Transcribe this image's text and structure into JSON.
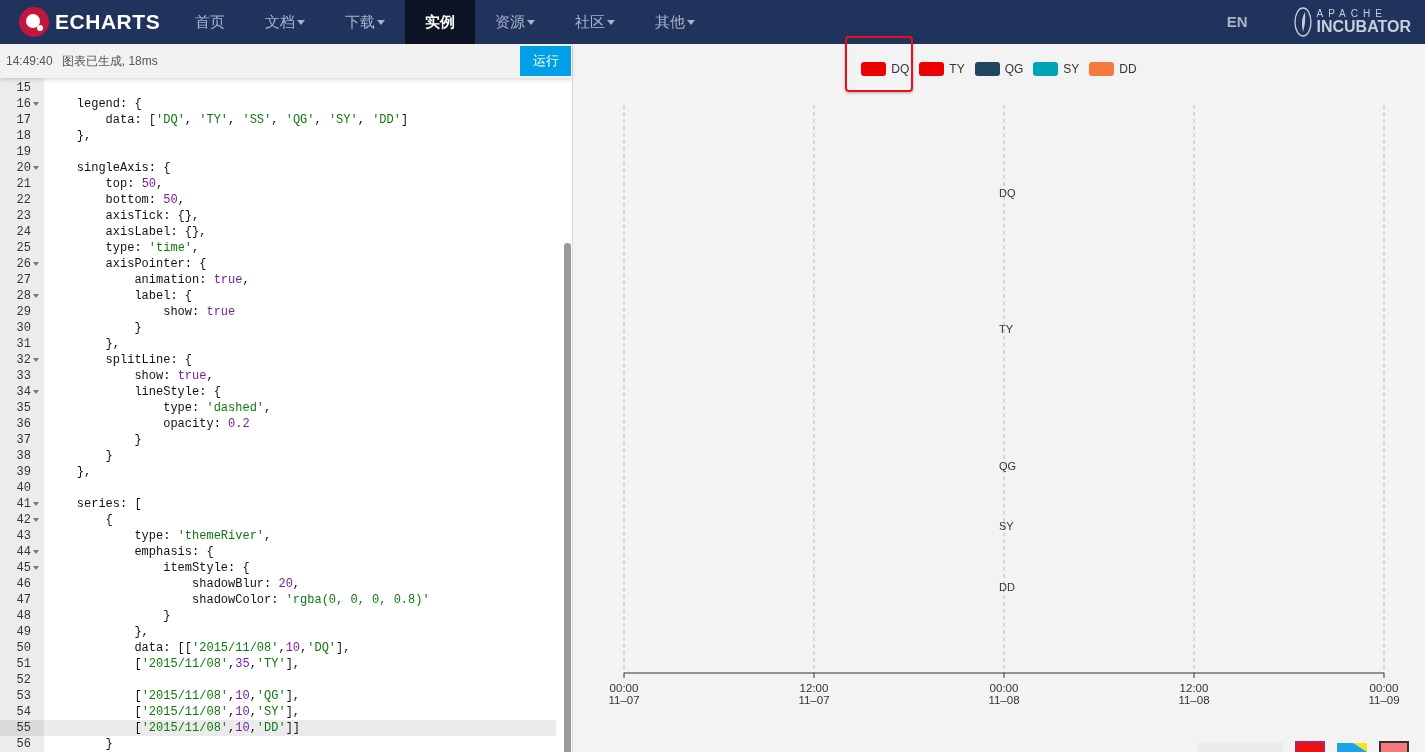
{
  "nav": {
    "brand": "ECHARTS",
    "items": [
      {
        "label": "首页",
        "dropdown": false,
        "selected": false
      },
      {
        "label": "文档",
        "dropdown": true,
        "selected": false
      },
      {
        "label": "下载",
        "dropdown": true,
        "selected": false
      },
      {
        "label": "实例",
        "dropdown": false,
        "selected": true
      },
      {
        "label": "资源",
        "dropdown": true,
        "selected": false
      },
      {
        "label": "社区",
        "dropdown": true,
        "selected": false
      },
      {
        "label": "其他",
        "dropdown": true,
        "selected": false
      }
    ],
    "language": "EN",
    "incubator": {
      "top": "APACHE",
      "bottom": "INCUBATOR"
    }
  },
  "status_bar": {
    "time": "14:49:40",
    "message": "图表已生成, 18ms",
    "run_button": "运行"
  },
  "editor": {
    "lines": [
      {
        "number": "15",
        "fold": false,
        "current": false
      },
      {
        "number": "16",
        "fold": true,
        "current": false,
        "tokens": [
          {
            "kind": "plain",
            "text": "    legend: {"
          }
        ]
      },
      {
        "number": "17",
        "fold": false,
        "current": false,
        "tokens": [
          {
            "kind": "plain",
            "text": "        data: ["
          },
          {
            "kind": "string",
            "text": "'DQ'"
          },
          {
            "kind": "plain",
            "text": ", "
          },
          {
            "kind": "string",
            "text": "'TY'"
          },
          {
            "kind": "plain",
            "text": ", "
          },
          {
            "kind": "string",
            "text": "'SS'"
          },
          {
            "kind": "plain",
            "text": ", "
          },
          {
            "kind": "string",
            "text": "'QG'"
          },
          {
            "kind": "plain",
            "text": ", "
          },
          {
            "kind": "string",
            "text": "'SY'"
          },
          {
            "kind": "plain",
            "text": ", "
          },
          {
            "kind": "string",
            "text": "'DD'"
          },
          {
            "kind": "plain",
            "text": "]"
          }
        ]
      },
      {
        "number": "18",
        "fold": false,
        "current": false,
        "tokens": [
          {
            "kind": "plain",
            "text": "    },"
          }
        ]
      },
      {
        "number": "19",
        "fold": false,
        "current": false
      },
      {
        "number": "20",
        "fold": true,
        "current": false,
        "tokens": [
          {
            "kind": "plain",
            "text": "    singleAxis: {"
          }
        ]
      },
      {
        "number": "21",
        "fold": false,
        "current": false,
        "tokens": [
          {
            "kind": "plain",
            "text": "        top: "
          },
          {
            "kind": "literal",
            "text": "50"
          },
          {
            "kind": "plain",
            "text": ","
          }
        ]
      },
      {
        "number": "22",
        "fold": false,
        "current": false,
        "tokens": [
          {
            "kind": "plain",
            "text": "        bottom: "
          },
          {
            "kind": "literal",
            "text": "50"
          },
          {
            "kind": "plain",
            "text": ","
          }
        ]
      },
      {
        "number": "23",
        "fold": false,
        "current": false,
        "tokens": [
          {
            "kind": "plain",
            "text": "        axisTick: {},"
          }
        ]
      },
      {
        "number": "24",
        "fold": false,
        "current": false,
        "tokens": [
          {
            "kind": "plain",
            "text": "        axisLabel: {},"
          }
        ]
      },
      {
        "number": "25",
        "fold": false,
        "current": false,
        "tokens": [
          {
            "kind": "plain",
            "text": "        type: "
          },
          {
            "kind": "string",
            "text": "'time'"
          },
          {
            "kind": "plain",
            "text": ","
          }
        ]
      },
      {
        "number": "26",
        "fold": true,
        "current": false,
        "tokens": [
          {
            "kind": "plain",
            "text": "        axisPointer: {"
          }
        ]
      },
      {
        "number": "27",
        "fold": false,
        "current": false,
        "tokens": [
          {
            "kind": "plain",
            "text": "            animation: "
          },
          {
            "kind": "literal",
            "text": "true"
          },
          {
            "kind": "plain",
            "text": ","
          }
        ]
      },
      {
        "number": "28",
        "fold": true,
        "current": false,
        "tokens": [
          {
            "kind": "plain",
            "text": "            label: {"
          }
        ]
      },
      {
        "number": "29",
        "fold": false,
        "current": false,
        "tokens": [
          {
            "kind": "plain",
            "text": "                show: "
          },
          {
            "kind": "literal",
            "text": "true"
          }
        ]
      },
      {
        "number": "30",
        "fold": false,
        "current": false,
        "tokens": [
          {
            "kind": "plain",
            "text": "            }"
          }
        ]
      },
      {
        "number": "31",
        "fold": false,
        "current": false,
        "tokens": [
          {
            "kind": "plain",
            "text": "        },"
          }
        ]
      },
      {
        "number": "32",
        "fold": true,
        "current": false,
        "tokens": [
          {
            "kind": "plain",
            "text": "        splitLine: {"
          }
        ]
      },
      {
        "number": "33",
        "fold": false,
        "current": false,
        "tokens": [
          {
            "kind": "plain",
            "text": "            show: "
          },
          {
            "kind": "literal",
            "text": "true"
          },
          {
            "kind": "plain",
            "text": ","
          }
        ]
      },
      {
        "number": "34",
        "fold": true,
        "current": false,
        "tokens": [
          {
            "kind": "plain",
            "text": "            lineStyle: {"
          }
        ]
      },
      {
        "number": "35",
        "fold": false,
        "current": false,
        "tokens": [
          {
            "kind": "plain",
            "text": "                type: "
          },
          {
            "kind": "string",
            "text": "'dashed'"
          },
          {
            "kind": "plain",
            "text": ","
          }
        ]
      },
      {
        "number": "36",
        "fold": false,
        "current": false,
        "tokens": [
          {
            "kind": "plain",
            "text": "                opacity: "
          },
          {
            "kind": "literal",
            "text": "0.2"
          }
        ]
      },
      {
        "number": "37",
        "fold": false,
        "current": false,
        "tokens": [
          {
            "kind": "plain",
            "text": "            }"
          }
        ]
      },
      {
        "number": "38",
        "fold": false,
        "current": false,
        "tokens": [
          {
            "kind": "plain",
            "text": "        }"
          }
        ]
      },
      {
        "number": "39",
        "fold": false,
        "current": false,
        "tokens": [
          {
            "kind": "plain",
            "text": "    },"
          }
        ]
      },
      {
        "number": "40",
        "fold": false,
        "current": false
      },
      {
        "number": "41",
        "fold": true,
        "current": false,
        "tokens": [
          {
            "kind": "plain",
            "text": "    series: ["
          }
        ]
      },
      {
        "number": "42",
        "fold": true,
        "current": false,
        "tokens": [
          {
            "kind": "plain",
            "text": "        {"
          }
        ]
      },
      {
        "number": "43",
        "fold": false,
        "current": false,
        "tokens": [
          {
            "kind": "plain",
            "text": "            type: "
          },
          {
            "kind": "string",
            "text": "'themeRiver'"
          },
          {
            "kind": "plain",
            "text": ","
          }
        ]
      },
      {
        "number": "44",
        "fold": true,
        "current": false,
        "tokens": [
          {
            "kind": "plain",
            "text": "            emphasis: {"
          }
        ]
      },
      {
        "number": "45",
        "fold": true,
        "current": false,
        "tokens": [
          {
            "kind": "plain",
            "text": "                itemStyle: {"
          }
        ]
      },
      {
        "number": "46",
        "fold": false,
        "current": false,
        "tokens": [
          {
            "kind": "plain",
            "text": "                    shadowBlur: "
          },
          {
            "kind": "literal",
            "text": "20"
          },
          {
            "kind": "plain",
            "text": ","
          }
        ]
      },
      {
        "number": "47",
        "fold": false,
        "current": false,
        "tokens": [
          {
            "kind": "plain",
            "text": "                    shadowColor: "
          },
          {
            "kind": "string",
            "text": "'rgba(0, 0, 0, 0.8)'"
          }
        ]
      },
      {
        "number": "48",
        "fold": false,
        "current": false,
        "tokens": [
          {
            "kind": "plain",
            "text": "                }"
          }
        ]
      },
      {
        "number": "49",
        "fold": false,
        "current": false,
        "tokens": [
          {
            "kind": "plain",
            "text": "            },"
          }
        ]
      },
      {
        "number": "50",
        "fold": false,
        "current": false,
        "tokens": [
          {
            "kind": "plain",
            "text": "            data: [["
          },
          {
            "kind": "string",
            "text": "'2015/11/08'"
          },
          {
            "kind": "plain",
            "text": ","
          },
          {
            "kind": "literal",
            "text": "10"
          },
          {
            "kind": "plain",
            "text": ","
          },
          {
            "kind": "string",
            "text": "'DQ'"
          },
          {
            "kind": "plain",
            "text": "],"
          }
        ]
      },
      {
        "number": "51",
        "fold": false,
        "current": false,
        "tokens": [
          {
            "kind": "plain",
            "text": "            ["
          },
          {
            "kind": "string",
            "text": "'2015/11/08'"
          },
          {
            "kind": "plain",
            "text": ","
          },
          {
            "kind": "literal",
            "text": "35"
          },
          {
            "kind": "plain",
            "text": ","
          },
          {
            "kind": "string",
            "text": "'TY'"
          },
          {
            "kind": "plain",
            "text": "],"
          }
        ]
      },
      {
        "number": "52",
        "fold": false,
        "current": false
      },
      {
        "number": "53",
        "fold": false,
        "current": false,
        "tokens": [
          {
            "kind": "plain",
            "text": "            ["
          },
          {
            "kind": "string",
            "text": "'2015/11/08'"
          },
          {
            "kind": "plain",
            "text": ","
          },
          {
            "kind": "literal",
            "text": "10"
          },
          {
            "kind": "plain",
            "text": ","
          },
          {
            "kind": "string",
            "text": "'QG'"
          },
          {
            "kind": "plain",
            "text": "],"
          }
        ]
      },
      {
        "number": "54",
        "fold": false,
        "current": false,
        "tokens": [
          {
            "kind": "plain",
            "text": "            ["
          },
          {
            "kind": "string",
            "text": "'2015/11/08'"
          },
          {
            "kind": "plain",
            "text": ","
          },
          {
            "kind": "literal",
            "text": "10"
          },
          {
            "kind": "plain",
            "text": ","
          },
          {
            "kind": "string",
            "text": "'SY'"
          },
          {
            "kind": "plain",
            "text": "],"
          }
        ]
      },
      {
        "number": "55",
        "fold": false,
        "current": true,
        "tokens": [
          {
            "kind": "plain",
            "text": "            ["
          },
          {
            "kind": "string",
            "text": "'2015/11/08'"
          },
          {
            "kind": "plain",
            "text": ","
          },
          {
            "kind": "literal",
            "text": "10"
          },
          {
            "kind": "plain",
            "text": ","
          },
          {
            "kind": "string",
            "text": "'DD'"
          },
          {
            "kind": "plain",
            "text": "]]"
          }
        ]
      },
      {
        "number": "56",
        "fold": false,
        "current": false,
        "tokens": [
          {
            "kind": "plain",
            "text": "        }"
          }
        ]
      }
    ]
  },
  "legend": [
    {
      "label": "DQ",
      "color": "#ee0000",
      "highlighted": true
    },
    {
      "label": "TY",
      "color": "#ee0000",
      "highlighted": false
    },
    {
      "label": "QG",
      "color": "#1f4660",
      "highlighted": false
    },
    {
      "label": "SY",
      "color": "#00a5b5",
      "highlighted": false
    },
    {
      "label": "DD",
      "color": "#f5793e",
      "highlighted": false
    }
  ],
  "chart": {
    "series_labels": [
      "DQ",
      "TY",
      "QG",
      "SY",
      "DD"
    ],
    "axis_ticks": [
      {
        "time": "00:00",
        "date": "11–07"
      },
      {
        "time": "12:00",
        "date": "11–07"
      },
      {
        "time": "00:00",
        "date": "11–08"
      },
      {
        "time": "12:00",
        "date": "11–08"
      },
      {
        "time": "00:00",
        "date": "11–09"
      }
    ]
  }
}
